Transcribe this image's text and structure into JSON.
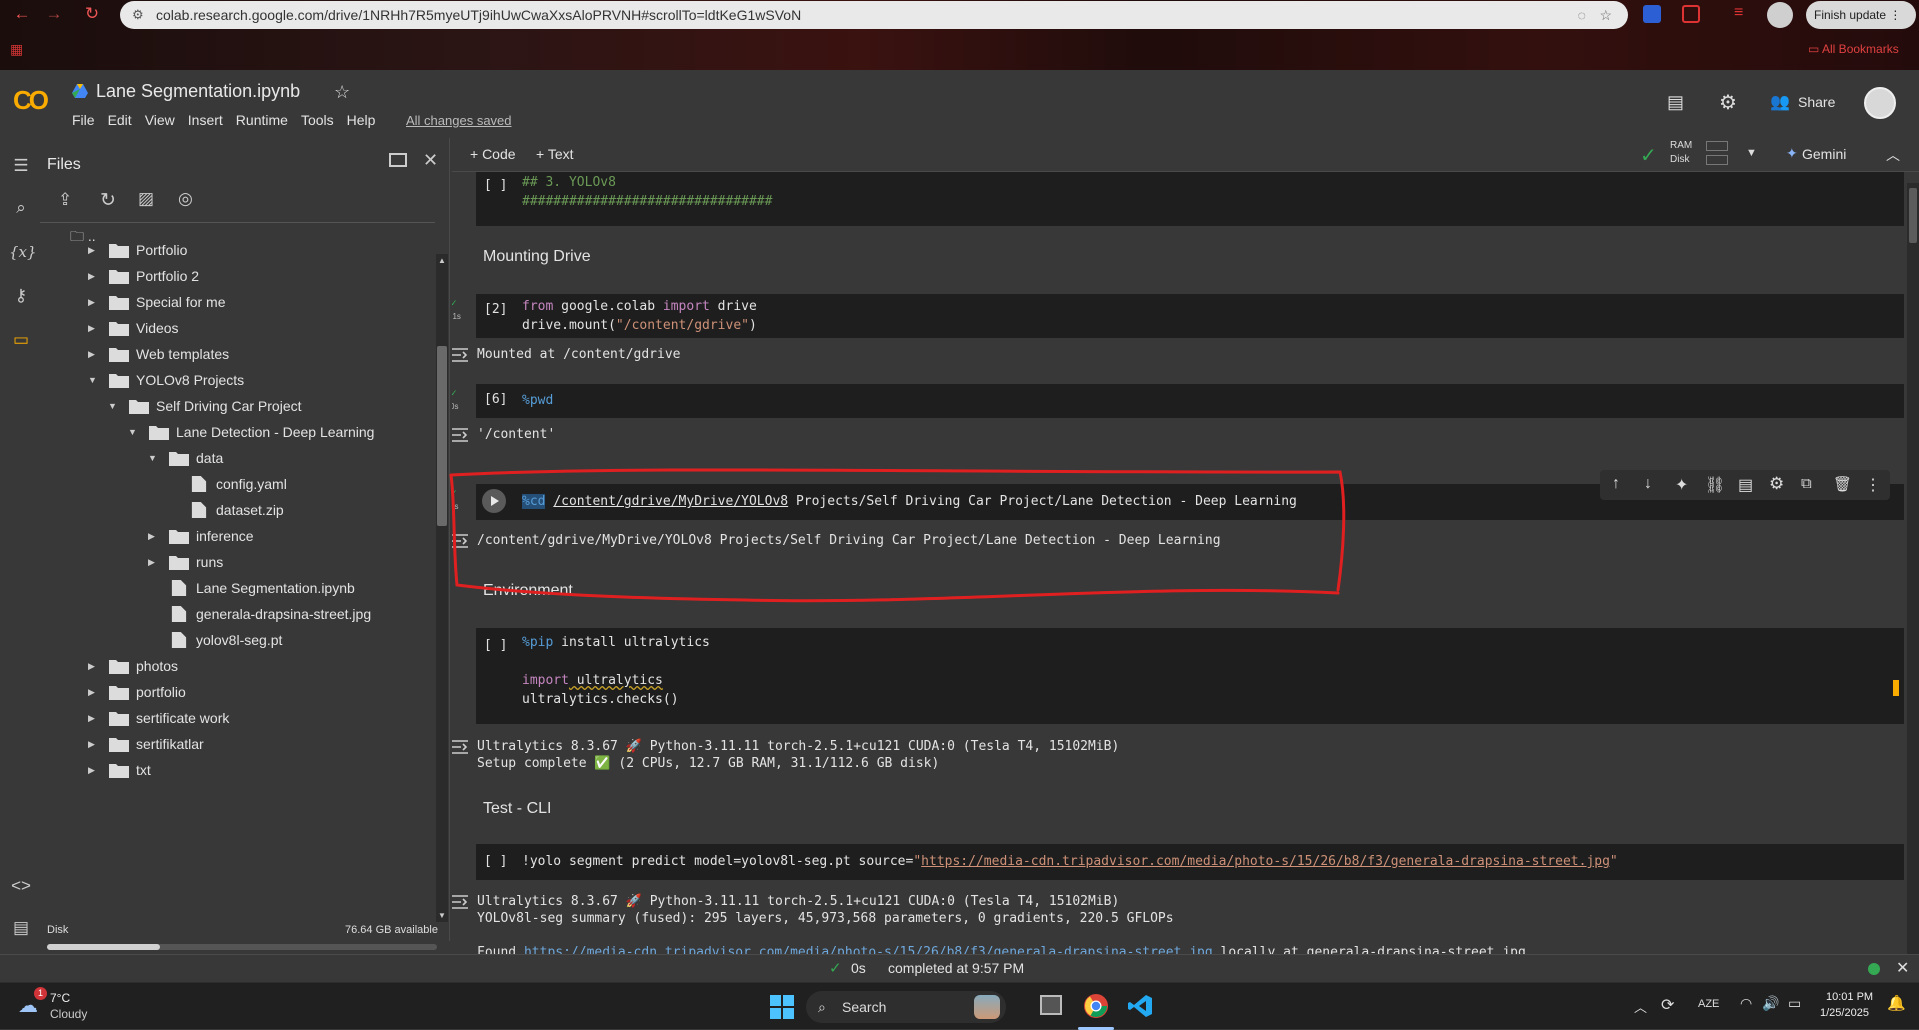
{
  "browser": {
    "url": "colab.research.google.com/drive/1NRHh7R5myeUTj9ihUwCwaXxsAloPRVNH#scrollTo=ldtKeG1wSVoN",
    "finish_update": "Finish update",
    "all_bookmarks": "All Bookmarks"
  },
  "header": {
    "logo": "CO",
    "title": "Lane Segmentation.ipynb",
    "menu": [
      "File",
      "Edit",
      "View",
      "Insert",
      "Runtime",
      "Tools",
      "Help"
    ],
    "saved_status": "All changes saved",
    "share": "Share"
  },
  "files_panel": {
    "title": "Files",
    "parent": "..",
    "tree": [
      {
        "label": "Portfolio",
        "type": "folder",
        "expanded": false
      },
      {
        "label": "Portfolio 2",
        "type": "folder",
        "expanded": false
      },
      {
        "label": "Special for me",
        "type": "folder",
        "expanded": false
      },
      {
        "label": "Videos",
        "type": "folder",
        "expanded": false
      },
      {
        "label": "Web templates",
        "type": "folder",
        "expanded": false
      },
      {
        "label": "YOLOv8 Projects",
        "type": "folder",
        "expanded": true
      },
      {
        "label": "Self Driving Car Project",
        "type": "folder",
        "expanded": true
      },
      {
        "label": "Lane Detection - Deep Learning",
        "type": "folder",
        "expanded": true
      },
      {
        "label": "data",
        "type": "folder",
        "expanded": true
      },
      {
        "label": "config.yaml",
        "type": "file"
      },
      {
        "label": "dataset.zip",
        "type": "file"
      },
      {
        "label": "inference",
        "type": "folder",
        "expanded": false
      },
      {
        "label": "runs",
        "type": "folder",
        "expanded": false
      },
      {
        "label": "Lane Segmentation.ipynb",
        "type": "file"
      },
      {
        "label": "generala-drapsina-street.jpg",
        "type": "file"
      },
      {
        "label": "yolov8l-seg.pt",
        "type": "file"
      },
      {
        "label": "photos",
        "type": "folder",
        "expanded": false
      },
      {
        "label": "portfolio",
        "type": "folder",
        "expanded": false
      },
      {
        "label": "sertificate work",
        "type": "folder",
        "expanded": false
      },
      {
        "label": "sertifikatlar",
        "type": "folder",
        "expanded": false
      },
      {
        "label": "txt",
        "type": "folder",
        "expanded": false
      }
    ],
    "disk_label": "Disk",
    "disk_available": "76.64 GB available",
    "disk_used_fraction": 0.29
  },
  "toolbar": {
    "add_code": "+ Code",
    "add_text": "+ Text",
    "ram": "RAM",
    "disk": "Disk",
    "gemini": "Gemini"
  },
  "cells": {
    "c1": {
      "bracket": "[ ]",
      "line1": "## 3. YOLOv8",
      "line2": "################################"
    },
    "md_mount": "Mounting Drive",
    "c2": {
      "bracket": "[2]",
      "time": "21s",
      "l1a": "from",
      "l1b": " google.colab ",
      "l1c": "import",
      "l1d": " drive",
      "l2a": "drive.mount(",
      "l2b": "\"/content/gdrive\"",
      "l2c": ")",
      "output": "Mounted at /content/gdrive"
    },
    "c3": {
      "bracket": "[6]",
      "time": "0s",
      "code": "%pwd",
      "output": "'/content'"
    },
    "c4": {
      "time": "0s",
      "magic": "%cd",
      "path": "/content/gdrive/MyDrive/YOLOv8",
      "rest": " Projects/Self Driving Car Project/Lane Detection - Deep Learning",
      "output": "/content/gdrive/MyDrive/YOLOv8 Projects/Self Driving Car Project/Lane Detection - Deep Learning"
    },
    "md_env": "Environment",
    "c5": {
      "bracket": "[ ]",
      "l1a": "%pip",
      "l1b": " install ultralytics",
      "l3a": "import",
      "l3b": " ultralytics",
      "l4": "ultralytics.checks()",
      "out1": "Ultralytics 8.3.67 🚀 Python-3.11.11 torch-2.5.1+cu121 CUDA:0 (Tesla T4, 15102MiB)",
      "out2a": "Setup complete ",
      "out2b": "✅",
      "out2c": " (2 CPUs, 12.7 GB RAM, 31.1/112.6 GB disk)"
    },
    "md_test": "Test - CLI",
    "c6": {
      "bracket": "[ ]",
      "a": "!yolo segment predict model=yolov8l-seg.pt source=",
      "q1": "\"",
      "link": "https://media-cdn.tripadvisor.com/media/photo-s/15/26/b8/f3/generala-drapsina-street.jpg",
      "q2": "\"",
      "out1": "Ultralytics 8.3.67 🚀 Python-3.11.11 torch-2.5.1+cu121 CUDA:0 (Tesla T4, 15102MiB)",
      "out2": "YOLOv8l-seg summary (fused): 295 layers, 45,973,568 parameters, 0 gradients, 220.5 GFLOPs",
      "out4a": "Found ",
      "out4b": "https://media-cdn.tripadvisor.com/media/photo-s/15/26/b8/f3/generala-drapsina-street.jpg",
      "out4c": " locally at generala-drapsina-street.jpg"
    }
  },
  "status": {
    "time": "0s",
    "completed": "completed at 9:57 PM"
  },
  "taskbar": {
    "temp": "7°C",
    "weather": "Cloudy",
    "search": "Search",
    "lang": "AZE",
    "clock": "10:01 PM",
    "date": "1/25/2025",
    "badge": "1"
  },
  "colors": {
    "accent": "#f9ab00",
    "annotation": "#e02020",
    "ok": "#34a853"
  }
}
